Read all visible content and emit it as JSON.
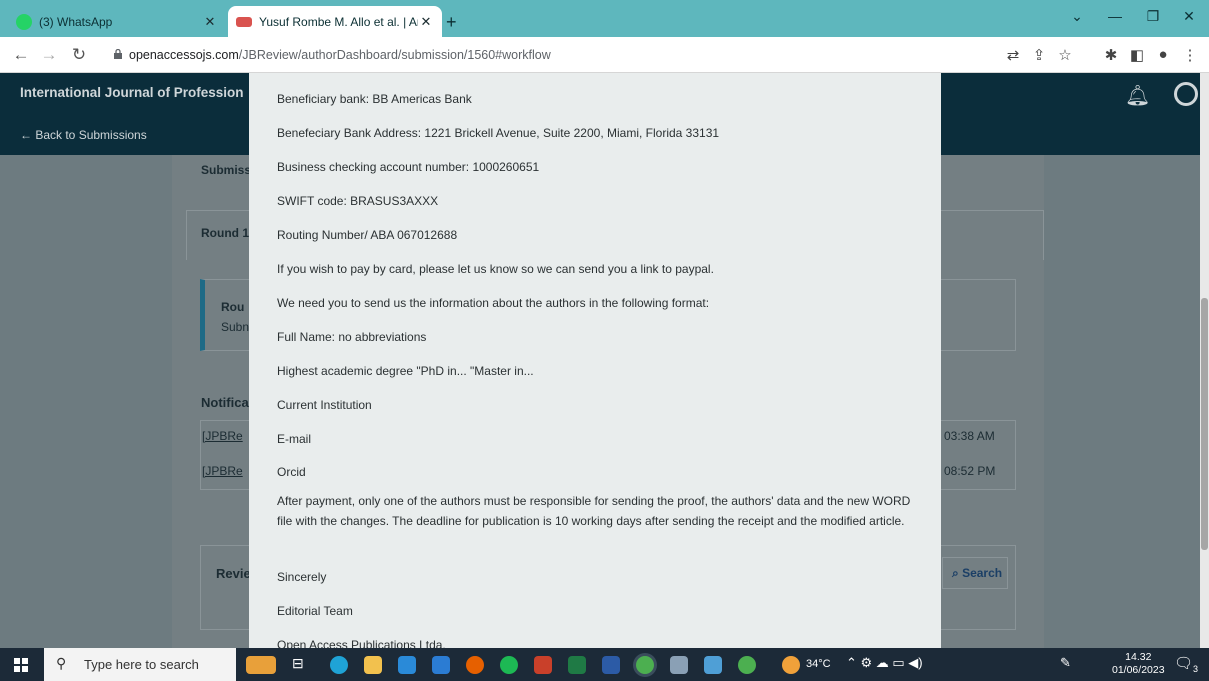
{
  "browser": {
    "tabs": [
      {
        "title": "(3) WhatsApp",
        "active": false
      },
      {
        "title": "Yusuf Rombe M. Allo et al. | Anal",
        "active": true
      }
    ],
    "url_host": "openaccessojs.com",
    "url_path": "/JBReview/authorDashboard/submission/1560#workflow"
  },
  "page": {
    "journal_title": "International Journal of Profession",
    "back_link": "← Back to Submissions",
    "submission_label": "Submiss",
    "round_tab": "Round 1",
    "round_box_title": "Rou",
    "round_box_sub": "Subn",
    "notifications_heading": "Notifica",
    "notif_rows": [
      {
        "link": "[JPBRe",
        "time": "03:38 AM"
      },
      {
        "link": "[JPBRe",
        "time": "08:52 PM"
      }
    ],
    "review_heading": "Revie",
    "search_label": "Search"
  },
  "modal": {
    "lines": [
      "Beneficiary bank: BB Americas Bank",
      "Benefeciary Bank Address: 1221 Brickell Avenue, Suite 2200, Miami, Florida 33131",
      "Business checking account number: 1000260651",
      "SWIFT code: BRASUS3AXXX",
      "Routing Number/ ABA 067012688",
      "If you wish to pay by card, please let us know so we can send you a link to paypal.",
      "We need you to send us the information about the authors in the following format:",
      "Full Name: no abbreviations",
      "Highest academic degree \"PhD in... \"Master in...",
      "Current Institution",
      "E-mail",
      "Orcid",
      "After payment, only one of the authors must be responsible for sending the proof, the authors' data and the new WORD file with the changes. The deadline for publication is 10 working days after sending the receipt and the modified article.",
      "Sincerely",
      "Editorial Team",
      "Open Access Publications Ltda."
    ]
  },
  "taskbar": {
    "search_placeholder": "Type here to search",
    "temperature": "34°C",
    "time": "14.32",
    "date": "01/06/2023",
    "notification_count": "3"
  }
}
